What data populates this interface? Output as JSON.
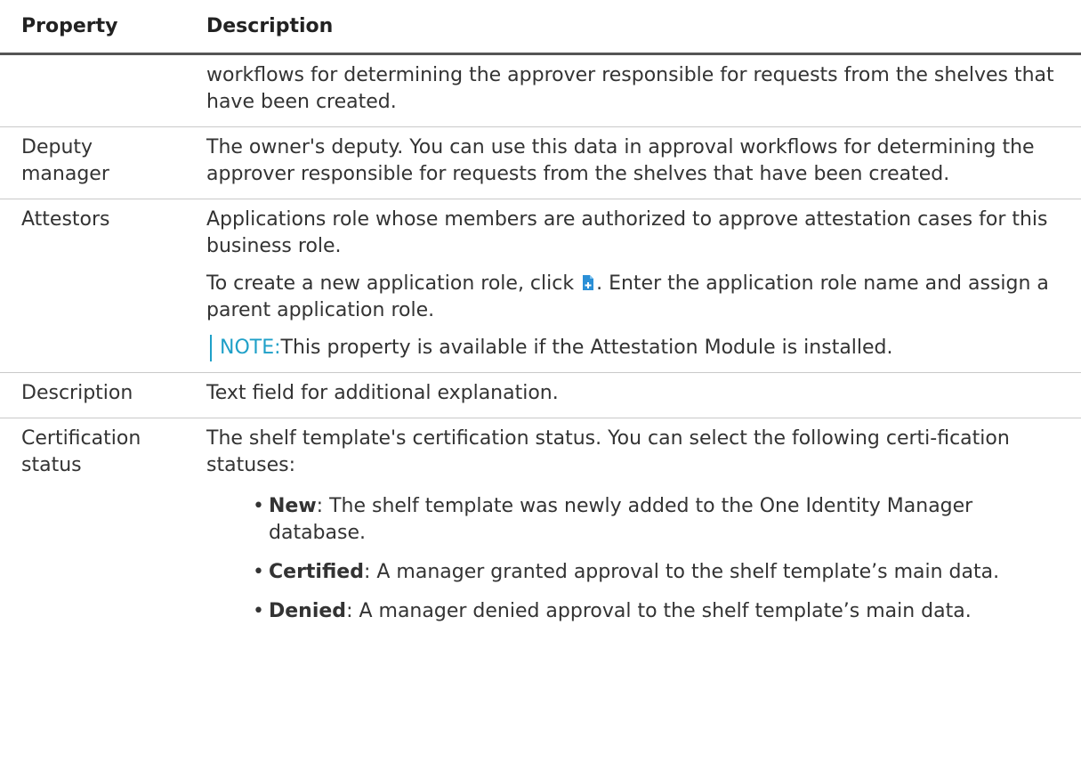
{
  "table": {
    "header": {
      "property": "Property",
      "description": "Description"
    },
    "rows": [
      {
        "property": "",
        "description": "workflows for determining the approver responsible for requests from the shelves that have been created."
      },
      {
        "property": "Deputy manager",
        "description": "The owner's deputy. You can use this data in approval workflows for determining the approver responsible for requests from the shelves that have been created."
      },
      {
        "property": "Attestors",
        "description": "Applications role whose members are authorized to approve attestation cases for this business role.",
        "create_text_before": "To create a new application role, click",
        "create_text_after": ". Enter the application role name and assign a parent application role.",
        "add_icon": "add-application-role-icon",
        "note_label": "NOTE:",
        "note_text": "This property is available if the Attestation Module is installed."
      },
      {
        "property": "Description",
        "description": "Text field for additional explanation."
      },
      {
        "property": "Certification status",
        "description": "The shelf template's certification status. You can select the following certi-fication statuses:",
        "statuses": [
          {
            "term": "New",
            "text": ": The shelf template was newly added to the One Identity Manager database."
          },
          {
            "term": "Certified",
            "text": ": A manager granted approval to the shelf template’s main data."
          },
          {
            "term": "Denied",
            "text": ": A manager denied approval to the shelf template’s main data."
          }
        ]
      }
    ]
  },
  "colors": {
    "note_accent": "#1fa0c8",
    "icon_blue": "#2b8fd6"
  }
}
